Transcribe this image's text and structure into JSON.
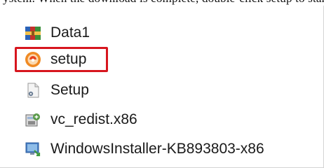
{
  "files": [
    {
      "label": "Data1",
      "icon": "winrar-archive-icon"
    },
    {
      "label": "setup",
      "icon": "setup-app-icon"
    },
    {
      "label": "Setup",
      "icon": "config-file-icon"
    },
    {
      "label": "vc_redist.x86",
      "icon": "installer-package-icon"
    },
    {
      "label": "WindowsInstaller-KB893803-x86",
      "icon": "windows-installer-icon"
    }
  ],
  "colors": {
    "highlight": "#d7161e",
    "text": "#1a1a1a"
  }
}
